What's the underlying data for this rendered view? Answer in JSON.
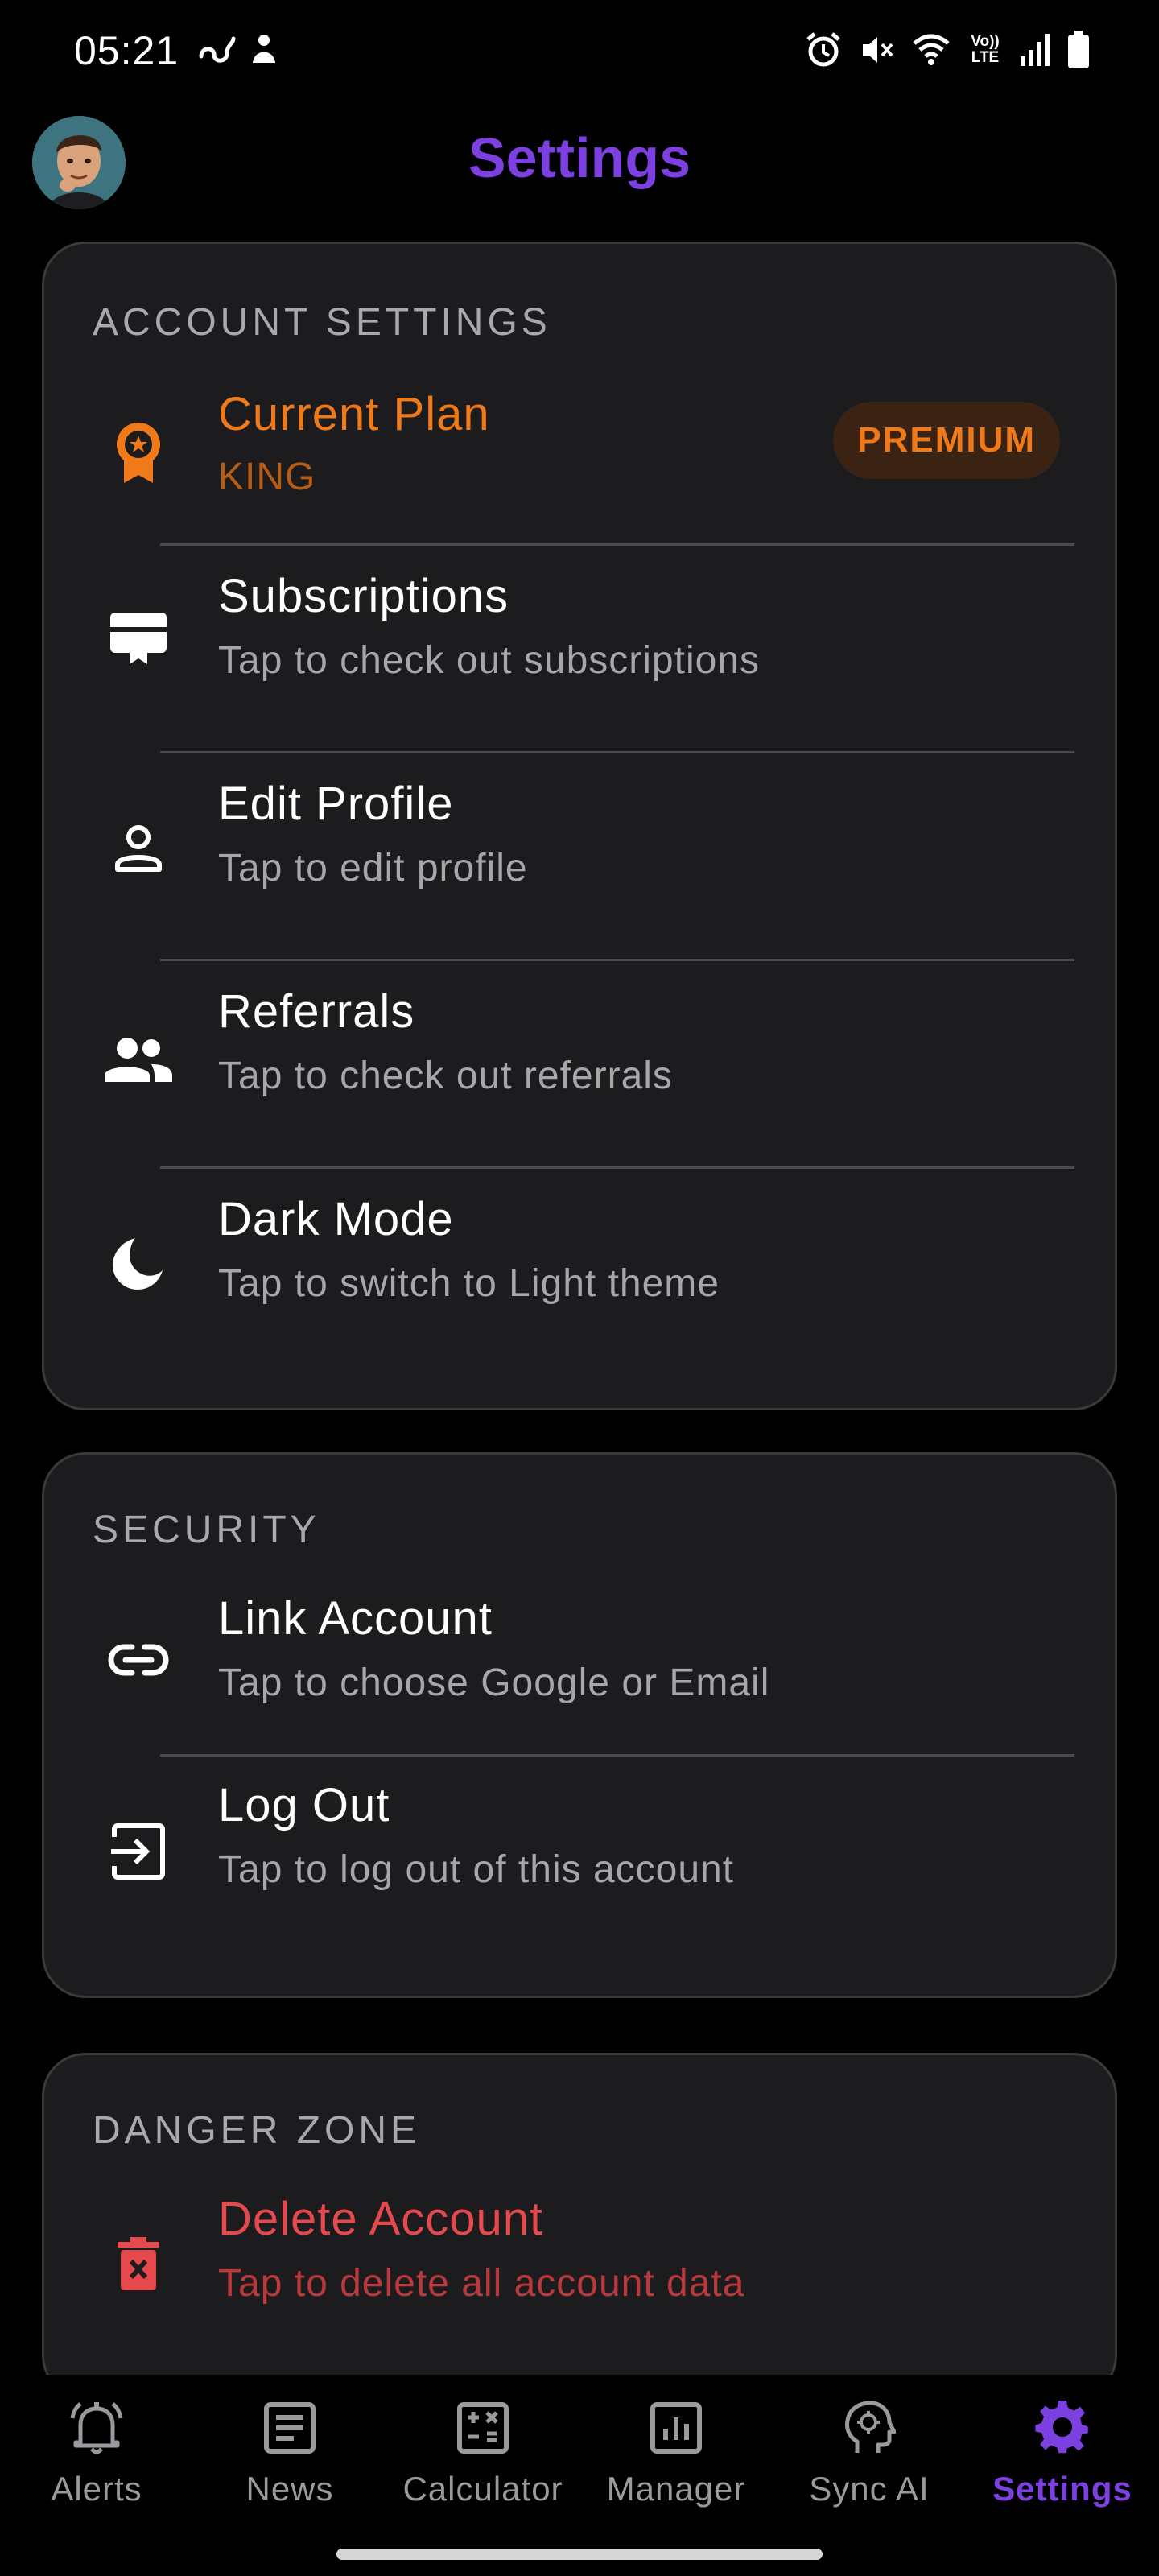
{
  "status_bar": {
    "time": "05:21",
    "left_icons": [
      "link-icon",
      "notification-icon"
    ],
    "right_icons": [
      "alarm-icon",
      "mute-icon",
      "wifi-icon",
      "volte-icon",
      "signal-icon",
      "battery-icon"
    ],
    "volte_text": "Vo)) LTE"
  },
  "header": {
    "title": "Settings"
  },
  "account_settings": {
    "title": "ACCOUNT SETTINGS",
    "current_plan": {
      "title": "Current Plan",
      "subtitle": "KING",
      "badge": "PREMIUM"
    },
    "items": [
      {
        "title": "Subscriptions",
        "subtitle": "Tap to check out subscriptions",
        "icon": "card-icon"
      },
      {
        "title": "Edit Profile",
        "subtitle": "Tap to edit profile",
        "icon": "person-icon"
      },
      {
        "title": "Referrals",
        "subtitle": "Tap to check out referrals",
        "icon": "people-icon"
      },
      {
        "title": "Dark Mode",
        "subtitle": "Tap to switch to Light theme",
        "icon": "moon-icon"
      }
    ]
  },
  "security": {
    "title": "SECURITY",
    "items": [
      {
        "title": "Link Account",
        "subtitle": "Tap to choose Google or Email",
        "icon": "link-icon"
      },
      {
        "title": "Log Out",
        "subtitle": "Tap to log out of this account",
        "icon": "logout-icon"
      }
    ]
  },
  "danger_zone": {
    "title": "DANGER ZONE",
    "delete": {
      "title": "Delete Account",
      "subtitle": "Tap to delete all account data"
    }
  },
  "bottom_nav": {
    "items": [
      {
        "label": "Alerts",
        "icon": "bell-icon"
      },
      {
        "label": "News",
        "icon": "news-icon"
      },
      {
        "label": "Calculator",
        "icon": "calculator-icon"
      },
      {
        "label": "Manager",
        "icon": "chart-icon"
      },
      {
        "label": "Sync AI",
        "icon": "ai-head-icon"
      },
      {
        "label": "Settings",
        "icon": "gear-icon"
      }
    ],
    "active": "Settings"
  },
  "colors": {
    "accent": "#7c3fe0",
    "premium": "#f07a1a",
    "danger": "#e5484d",
    "card": "#1c1c1e"
  }
}
